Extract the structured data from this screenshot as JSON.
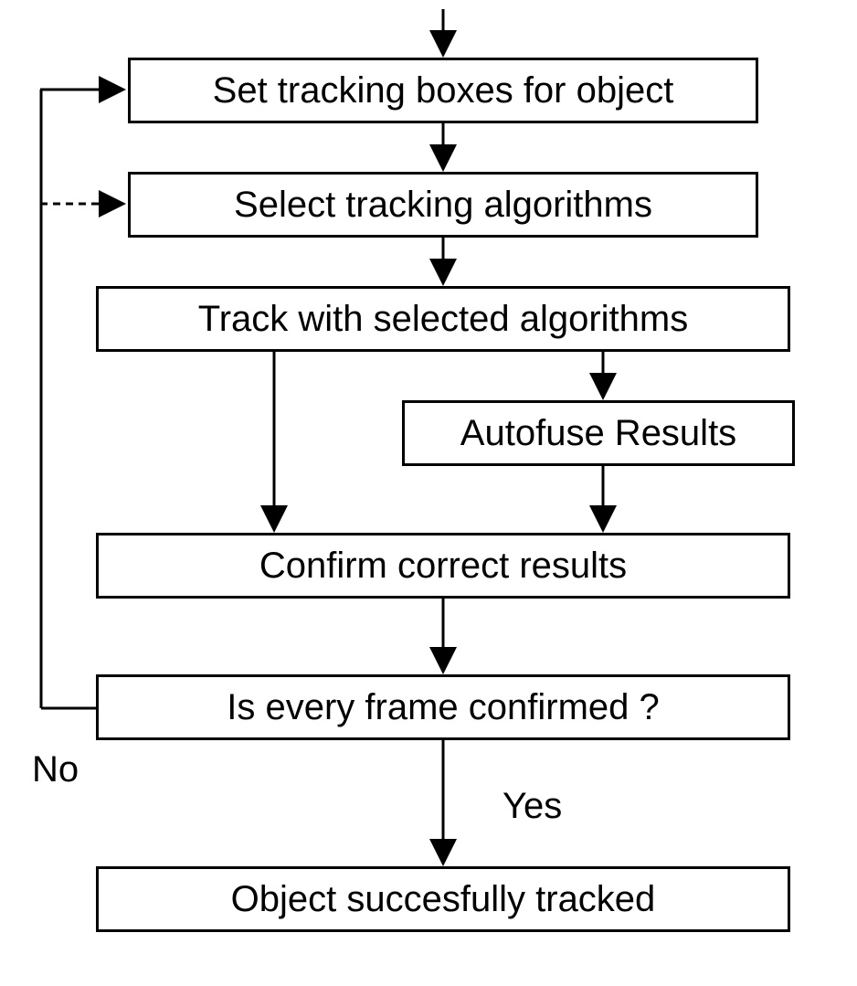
{
  "nodes": {
    "set_boxes": "Set tracking boxes for object",
    "select_algo": "Select tracking algorithms",
    "track": "Track with selected algorithms",
    "autofuse": "Autofuse Results",
    "confirm": "Confirm correct results",
    "decision": "Is every frame confirmed ?",
    "success": "Object succesfully tracked"
  },
  "labels": {
    "no": "No",
    "yes": "Yes"
  }
}
